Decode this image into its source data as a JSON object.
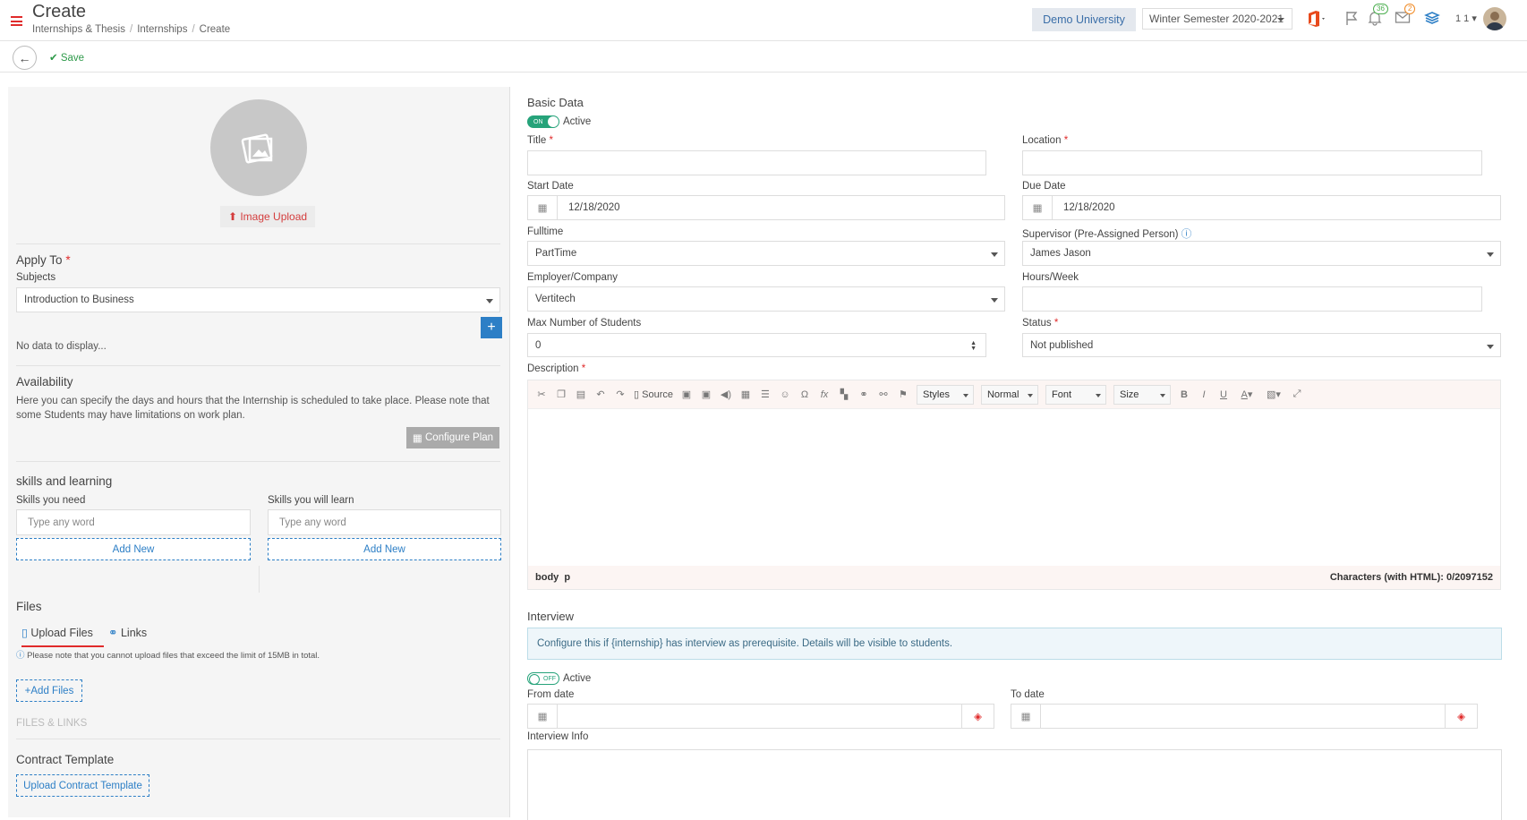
{
  "header": {
    "title": "Create",
    "breadcrumbs": [
      "Internships & Thesis",
      "Internships",
      "Create"
    ],
    "university": "Demo University",
    "semester": "Winter Semester 2020-2021",
    "notifications_count": "36",
    "messages_count": "2",
    "user_label": "1 1"
  },
  "toolbar": {
    "save_label": "Save"
  },
  "left": {
    "image_upload": "Image Upload",
    "apply_to": "Apply To",
    "subjects_label": "Subjects",
    "subjects_value": "Introduction to Business",
    "no_data": "No data to display...",
    "availability_title": "Availability",
    "availability_text": "Here you can specify the days and hours that the Internship is scheduled to take place. Please note that some Students may have limitations on work plan.",
    "configure_plan": "Configure Plan",
    "skills_title": "skills and learning",
    "skills_need_label": "Skills you need",
    "skills_learn_label": "Skills you will learn",
    "skills_placeholder": "Type any word",
    "add_new": "Add New",
    "files_title": "Files",
    "tab_upload": "Upload Files",
    "tab_links": "Links",
    "files_note": "Please note that you cannot upload files that exceed the limit of 15MB in total.",
    "add_files": "Add Files",
    "files_links": "FILES & LINKS",
    "contract_title": "Contract Template",
    "upload_contract": "Upload Contract Template"
  },
  "basic": {
    "section": "Basic Data",
    "toggle_on": "ON",
    "active": "Active",
    "title_label": "Title",
    "location_label": "Location",
    "start_date_label": "Start Date",
    "start_date": "12/18/2020",
    "due_date_label": "Due Date",
    "due_date": "12/18/2020",
    "fulltime_label": "Fulltime",
    "fulltime_value": "PartTime",
    "supervisor_label": "Supervisor (Pre-Assigned Person)",
    "supervisor_value": "James Jason",
    "employer_label": "Employer/Company",
    "employer_value": "Vertitech",
    "hours_label": "Hours/Week",
    "max_students_label": "Max Number of Students",
    "max_students_value": "0",
    "status_label": "Status",
    "status_value": "Not published",
    "description_label": "Description"
  },
  "editor": {
    "source": "Source",
    "styles": "Styles",
    "format": "Normal",
    "font": "Font",
    "size": "Size",
    "footer_path": "body  p",
    "char_count": "Characters (with HTML): 0/2097152"
  },
  "interview": {
    "section": "Interview",
    "info": "Configure this if {internship} has interview as prerequisite. Details will be visible to students.",
    "toggle_off": "OFF",
    "active": "Active",
    "from_label": "From date",
    "to_label": "To date",
    "info_label": "Interview Info"
  },
  "colors": {
    "accent": "#2d7fc6",
    "danger": "#e02b2b",
    "toggle": "#26a37a",
    "save": "#2e9a4a"
  }
}
